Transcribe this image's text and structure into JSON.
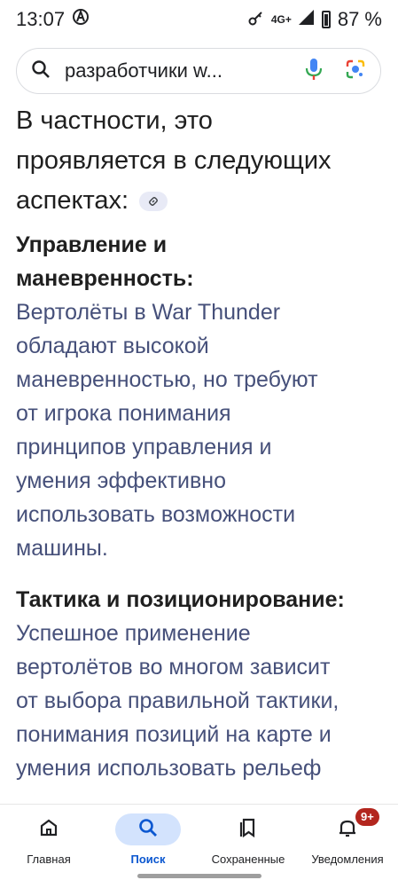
{
  "status": {
    "time": "13:07",
    "network": "4G+",
    "battery": "87 %",
    "icons": [
      "vpn-icon",
      "key-icon",
      "signal-icon",
      "battery-icon"
    ]
  },
  "search": {
    "query": "разработчики w...",
    "icons": [
      "search-icon",
      "mic-icon",
      "lens-icon"
    ]
  },
  "article": {
    "heading_line1": "В частности, это",
    "heading_line2": "проявляется в следующих",
    "heading_line3": "аспектах:",
    "section1": {
      "title_line1": "Управление и",
      "title_line2": "маневренность:",
      "lines": [
        "Вертолёты в War Thunder",
        "обладают высокой",
        "маневренностью, но требуют",
        "от игрока понимания",
        "принципов управления и",
        "умения эффективно",
        "использовать возможности",
        "машины."
      ]
    },
    "section2": {
      "title": "Тактика и позиционирование:",
      "lines": [
        "Успешное применение",
        "вертолётов во многом зависит",
        "от выбора правильной тактики,",
        "понимания позиций на карте и",
        "умения использовать рельеф"
      ]
    }
  },
  "nav": {
    "items": [
      {
        "label": "Главная",
        "icon": "home-icon"
      },
      {
        "label": "Поиск",
        "icon": "search-icon",
        "active": true
      },
      {
        "label": "Сохраненные",
        "icon": "bookmark-icon"
      },
      {
        "label": "Уведомления",
        "icon": "bell-icon",
        "badge": "9+"
      }
    ]
  },
  "colors": {
    "accent": "#0b57d0",
    "active_pill": "#d3e3fd",
    "body_text": "#46507a",
    "badge": "#b3261e"
  }
}
